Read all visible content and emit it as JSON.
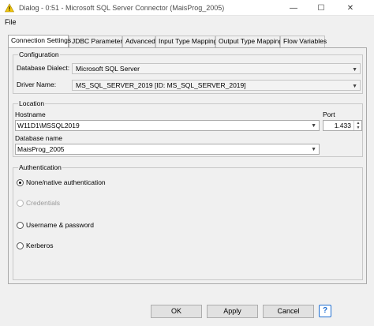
{
  "window": {
    "title": "Dialog - 0:51 - Microsoft SQL Server Connector (MaisProg_2005)",
    "minimize_glyph": "—",
    "maximize_glyph": "☐",
    "close_glyph": "✕",
    "icon": "warning-triangle-icon"
  },
  "menu": {
    "file": "File"
  },
  "tabs": [
    {
      "label": "Connection Settings",
      "active": true
    },
    {
      "label": "JDBC Parameters"
    },
    {
      "label": "Advanced"
    },
    {
      "label": "Input Type Mapping"
    },
    {
      "label": "Output Type Mapping"
    },
    {
      "label": "Flow Variables"
    }
  ],
  "configuration": {
    "title": "Configuration",
    "dialect_label": "Database Dialect:",
    "dialect_value": "Microsoft SQL Server",
    "driver_label": "Driver Name:",
    "driver_value": "MS_SQL_SERVER_2019 [ID: MS_SQL_SERVER_2019]"
  },
  "location": {
    "title": "Location",
    "hostname_label": "Hostname",
    "hostname_value": "W11D1\\MSSQL2019",
    "port_label": "Port",
    "port_value": "1.433",
    "dbname_label": "Database name",
    "dbname_value": "MaisProg_2005"
  },
  "authentication": {
    "title": "Authentication",
    "options": [
      {
        "label": "None/native authentication",
        "checked": true,
        "enabled": true
      },
      {
        "label": "Credentials",
        "checked": false,
        "enabled": false
      },
      {
        "label": "Username & password",
        "checked": false,
        "enabled": true
      },
      {
        "label": "Kerberos",
        "checked": false,
        "enabled": true
      }
    ]
  },
  "buttons": {
    "ok": "OK",
    "apply": "Apply",
    "cancel": "Cancel",
    "help": "?"
  },
  "colors": {
    "warning_icon": "#f2c811",
    "help_accent": "#1e6ed1"
  }
}
